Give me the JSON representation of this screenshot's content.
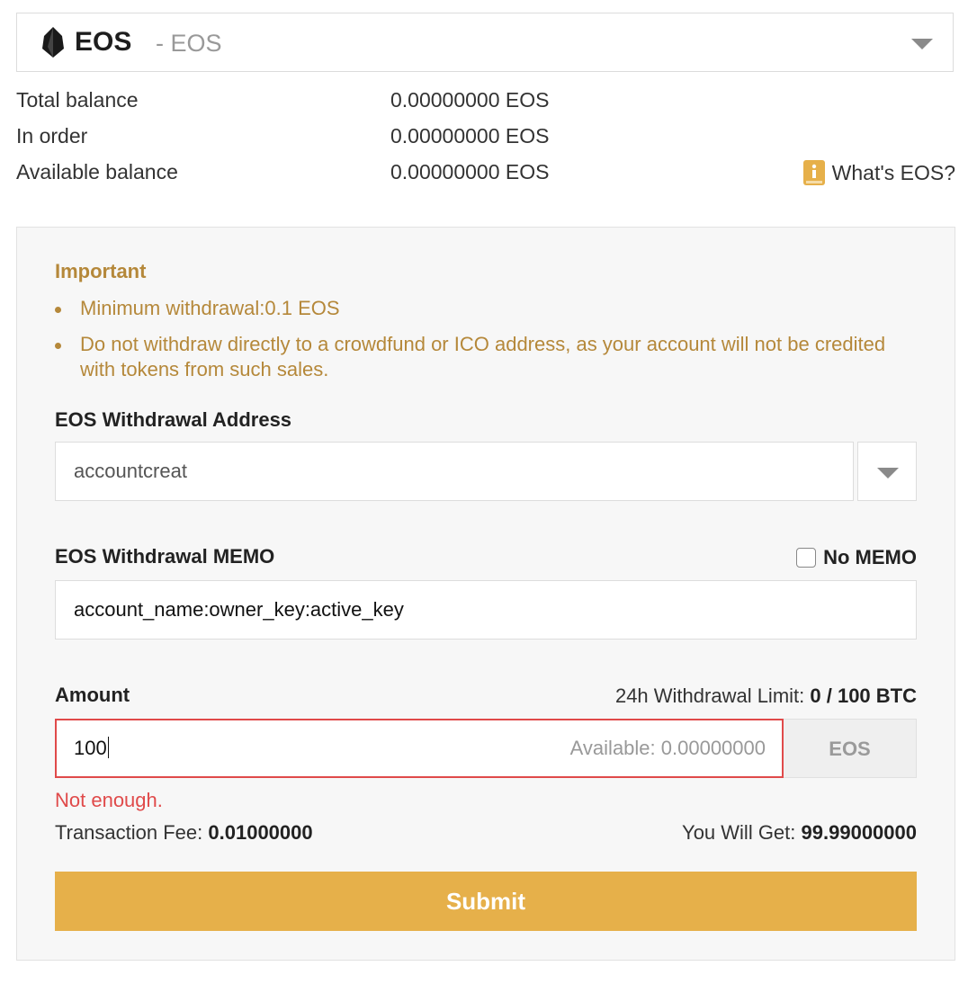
{
  "coin_select": {
    "symbol": "EOS",
    "separator_name": "- EOS",
    "icon": "eos-logo-icon",
    "dropdown_icon": "caret-down-icon"
  },
  "balances": [
    {
      "label": "Total balance",
      "value": "0.00000000 EOS"
    },
    {
      "label": "In order",
      "value": "0.00000000 EOS"
    },
    {
      "label": "Available balance",
      "value": "0.00000000 EOS"
    }
  ],
  "whats_link": {
    "icon": "info-book-icon",
    "label": "What's EOS?"
  },
  "important": {
    "title": "Important",
    "items": [
      "Minimum withdrawal:0.1 EOS",
      "Do not withdraw directly to a crowdfund or ICO address, as your account will not be credited with tokens from such sales."
    ]
  },
  "address": {
    "label": "EOS Withdrawal Address",
    "value": "accountcreat",
    "dropdown_icon": "caret-down-icon"
  },
  "memo": {
    "label": "EOS Withdrawal MEMO",
    "no_memo_label": "No MEMO",
    "no_memo_checked": false,
    "value": "account_name:owner_key:active_key"
  },
  "amount": {
    "label": "Amount",
    "limit_label": "24h Withdrawal Limit:",
    "limit_value": "0 / 100 BTC",
    "value": "100",
    "available": "Available: 0.00000000",
    "unit": "EOS",
    "error": "Not enough."
  },
  "fee": {
    "label": "Transaction Fee:",
    "value": "0.01000000"
  },
  "you_get": {
    "label": "You Will Get:",
    "value": "99.99000000"
  },
  "submit_label": "Submit",
  "colors": {
    "accent": "#e6b04a",
    "warning_text": "#b5883a",
    "error": "#e04a4a"
  }
}
